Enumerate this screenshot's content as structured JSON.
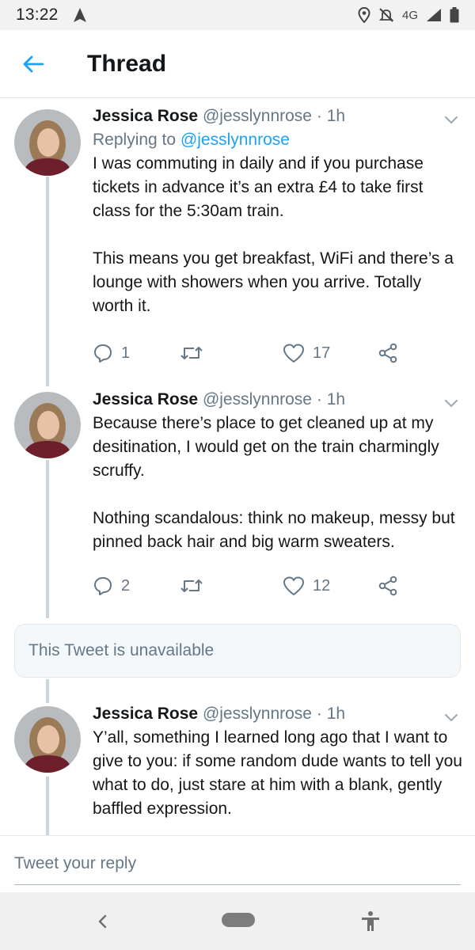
{
  "status_bar": {
    "time": "13:22",
    "network": "4G",
    "icons": [
      "navigation-arrow-icon",
      "location-pin-icon",
      "do-not-disturb-icon",
      "signal-icon",
      "battery-icon"
    ]
  },
  "header": {
    "title": "Thread",
    "back_icon": "back-arrow-icon"
  },
  "tweets": [
    {
      "name": "Jessica Rose",
      "handle": "@jesslynnrose",
      "dot": "·",
      "time": "1h",
      "replying_prefix": "Replying to",
      "replying_to": "@jesslynnrose",
      "text": "I was commuting in daily and if you purchase tickets in advance it’s an extra £4 to take first class for the 5:30am train.\n\nThis means you get breakfast, WiFi and there’s a lounge with showers when you arrive. Totally worth it.",
      "reply_count": "1",
      "like_count": "17"
    },
    {
      "name": "Jessica Rose",
      "handle": "@jesslynnrose",
      "dot": "·",
      "time": "1h",
      "text": "Because there’s place to get cleaned up at my desitination, I would get on the train charmingly scruffy.\n\nNothing scandalous: think no makeup, messy but pinned back hair and big warm sweaters.",
      "reply_count": "2",
      "like_count": "12"
    },
    {
      "name": "Jessica Rose",
      "handle": "@jesslynnrose",
      "dot": "·",
      "time": "1h",
      "text": "Y’all, something I learned long ago that I want to give to you: if some random dude wants to tell you what to do, just stare at him with a blank, gently baffled expression."
    }
  ],
  "unavailable_text": "This Tweet is unavailable",
  "reply_bar": {
    "placeholder": "Tweet your reply"
  },
  "colors": {
    "accent": "#1da1f2",
    "secondary_text": "#657786",
    "thread_line": "#ccd6dd"
  }
}
